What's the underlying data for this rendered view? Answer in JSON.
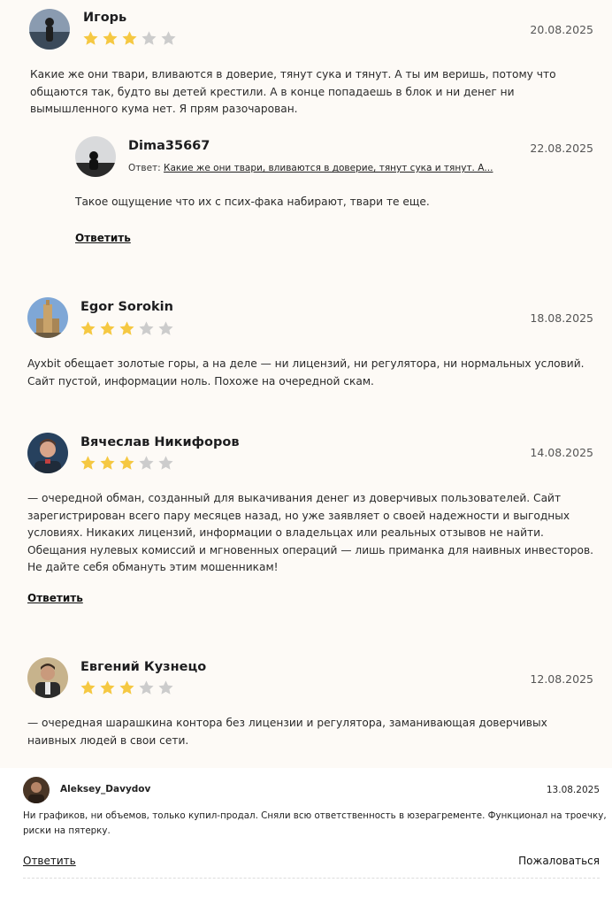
{
  "reviews": [
    {
      "name": "Игорь",
      "date": "20.08.2025",
      "rating": 3,
      "text": "Какие же они твари, вливаются в доверие, тянут сука и тянут. А ты им веришь, потому что общаются так, будто вы детей крестили. А в конце попадаешь в блок и ни денег ни вымышленного кума нет. Я прям разочарован.",
      "avatar": "person-silhouette",
      "reply": {
        "name": "Dima35667",
        "date": "22.08.2025",
        "answer_prefix": "Ответ:",
        "answer_quote": "Какие же они твари, вливаются в доверие, тянут сука и тянут. А...",
        "text": "Такое ощущение что их с псих-фака набирают, твари те еще.",
        "reply_label": "Ответить",
        "avatar": "person-sunset"
      }
    },
    {
      "name": "Egor Sorokin",
      "date": "18.08.2025",
      "rating": 3,
      "text": "Ayxbit обещает золотые горы, а на деле — ни лицензий, ни регулятора, ни нормальных условий. Сайт пустой, информации ноль. Похоже на очередной скам.",
      "avatar": "tower-photo"
    },
    {
      "name": "Вячеслав Никифоров",
      "date": "14.08.2025",
      "rating": 3,
      "text": "— очередной обман, созданный для выкачивания денег из доверчивых пользователей. Сайт зарегистрирован всего пару месяцев назад, но уже заявляет о своей надежности и выгодных условиях. Никаких лицензий, информации о владельцах или реальных отзывов не найти. Обещания нулевых комиссий и мгновенных операций — лишь приманка для наивных инвесторов. Не дайте себя обмануть этим мошенникам!",
      "reply_label": "Ответить",
      "avatar": "man-portrait"
    },
    {
      "name": "Евгений Кузнецо",
      "date": "12.08.2025",
      "rating": 3,
      "text": "— очередная шарашкина контора без лицензии и регулятора, заманивающая доверчивых наивных людей в свои сети.",
      "avatar": "man-jacket"
    }
  ],
  "bottom": {
    "name": "Aleksey_Davydov",
    "date": "13.08.2025",
    "text": "Ни графиков, ни объемов, только купил-продал. Сняли всю ответственность в юзерагременте. Функционал на троечку, риски на пятерку.",
    "reply_label": "Ответить",
    "report_label": "Пожаловаться",
    "avatar": "man-dark"
  },
  "colors": {
    "background": "#fdfaf6",
    "star_filled": "#f5c842",
    "star_empty": "#cccccc"
  }
}
